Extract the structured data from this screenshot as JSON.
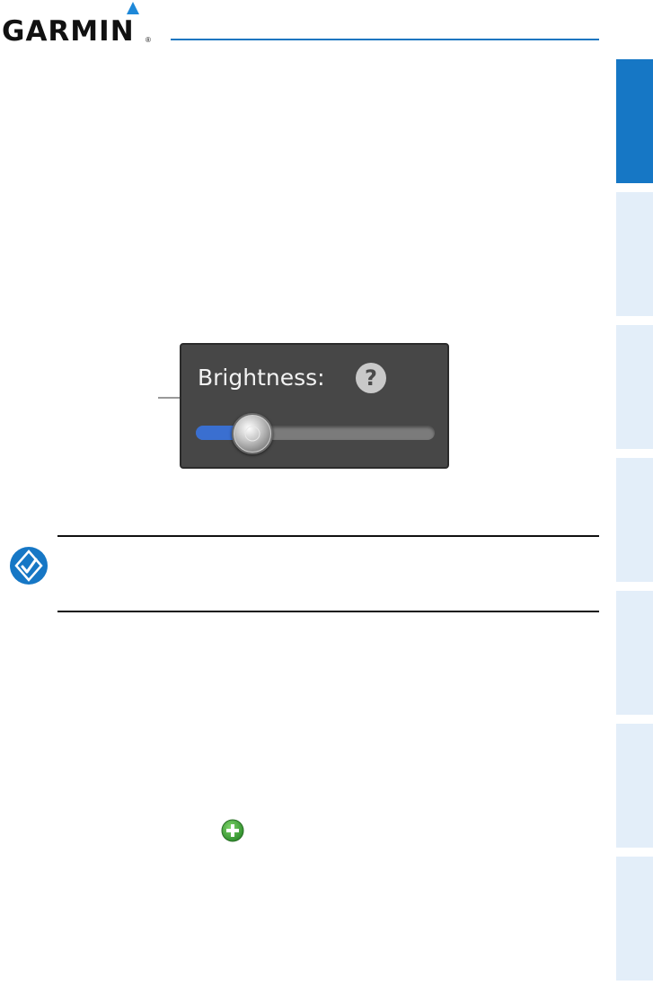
{
  "header": {
    "logo_text": "GARMIN",
    "logo_reg": "®",
    "accent_color": "#1a76c0"
  },
  "side_tabs": {
    "count": 7,
    "active_index": 0,
    "active_color": "#1677c5",
    "inactive_color": "#e3eef9"
  },
  "brightness": {
    "label": "Brightness:",
    "help_glyph": "?",
    "level": 0.2
  },
  "note": {
    "icon": "pencil-check-icon"
  },
  "add_button": {
    "icon": "plus-circle-icon",
    "color": "#3aa537"
  }
}
